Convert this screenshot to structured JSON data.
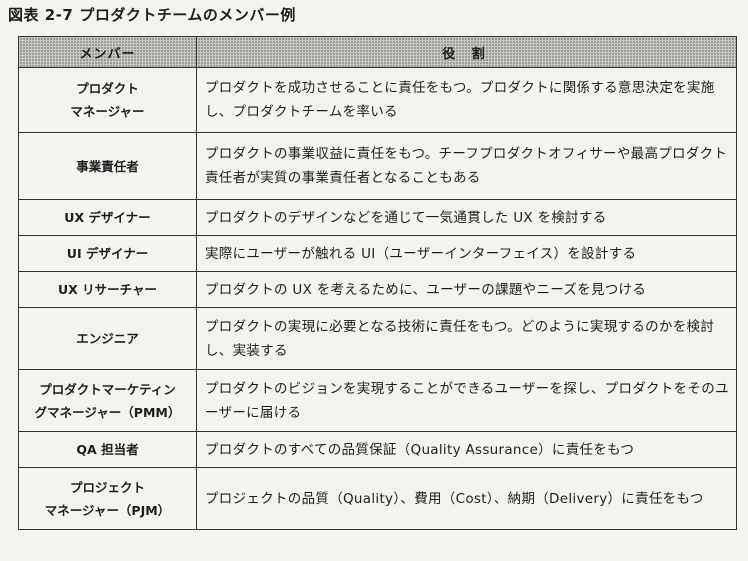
{
  "caption": {
    "label": "図表 2-7",
    "title": "プロダクトチームのメンバー例"
  },
  "table": {
    "headers": [
      "メンバー",
      "役 割"
    ],
    "rows": [
      {
        "member_lines": [
          "プロダクト",
          "マネージャー"
        ],
        "role": "プロダクトを成功させることに責任をもつ。プロダクトに関係する意思決定を実施し、プロダクトチームを率いる"
      },
      {
        "member_lines": [
          "事業責任者"
        ],
        "role": "プロダクトの事業収益に責任をもつ。チーフプロダクトオフィサーや最高プロダクト責任者が実質の事業責任者となることもある"
      },
      {
        "member_lines": [
          "UX デザイナー"
        ],
        "role": "プロダクトのデザインなどを通じて一気通貫した UX を検討する"
      },
      {
        "member_lines": [
          "UI デザイナー"
        ],
        "role": "実際にユーザーが触れる UI（ユーザーインターフェイス）を設計する"
      },
      {
        "member_lines": [
          "UX リサーチャー"
        ],
        "role": "プロダクトの UX を考えるために、ユーザーの課題やニーズを見つける"
      },
      {
        "member_lines": [
          "エンジニア"
        ],
        "role": "プロダクトの実現に必要となる技術に責任をもつ。どのように実現するのかを検討し、実装する"
      },
      {
        "member_lines": [
          "プロダクトマーケティン",
          "グマネージャー（PMM）"
        ],
        "role": "プロダクトのビジョンを実現することができるユーザーを探し、プロダクトをそのユーザーに届ける"
      },
      {
        "member_lines": [
          "QA 担当者"
        ],
        "role": "プロダクトのすべての品質保証（Quality Assurance）に責任をもつ"
      },
      {
        "member_lines": [
          "プロジェクト",
          "マネージャー（PJM）"
        ],
        "role": "プロジェクトの品質（Quality）、費用（Cost）、納期（Delivery）に責任をもつ"
      }
    ]
  }
}
